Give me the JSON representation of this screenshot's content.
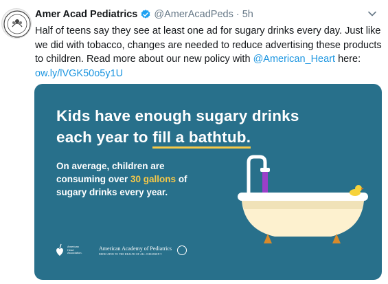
{
  "tweet": {
    "author_name": "Amer Acad Pediatrics",
    "handle": "@AmerAcadPeds",
    "separator": "·",
    "time": "5h",
    "text_part1": "Half of teens say they see at least one ad for sugary drinks every day. Just like we did with tobacco, changes are needed to reduce advertising these products to children. Read more about our new policy with ",
    "mention": "@American_Heart",
    "text_part2": " here:",
    "link": "ow.ly/lVGK50o5y1U"
  },
  "card": {
    "headline_line1": "Kids have enough sugary drinks",
    "headline_line2_a": "each year to ",
    "headline_line2_b": "fill a bathtub.",
    "body_a": "On average, children are consuming over ",
    "body_hl": "30 gallons",
    "body_b": " of sugary drinks every year.",
    "aha_text_1": "American",
    "aha_text_2": "Heart",
    "aha_text_3": "Association.",
    "aap_name": "American Academy of Pediatrics",
    "aap_tagline": "DEDICATED TO THE HEALTH OF ALL CHILDREN™"
  },
  "colors": {
    "card_bg": "#28708b",
    "accent_yellow": "#f7c948",
    "link_blue": "#1b95e0",
    "verified_blue": "#1da1f2"
  },
  "icons": {
    "avatar": "aap-seal-avatar",
    "verified": "verified-badge-icon",
    "caret": "chevron-down-icon"
  }
}
